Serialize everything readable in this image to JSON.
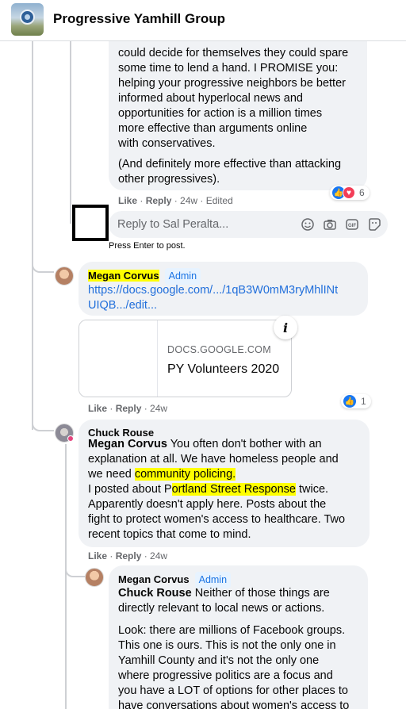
{
  "header": {
    "group_name": "Progressive Yamhill Group"
  },
  "comment1": {
    "lines": [
      "could decide for themselves they could spare",
      "some time to lend a hand. I PROMISE you:",
      "helping your progressive neighbors be better",
      "informed about hyperlocal news and",
      "opportunities for action is a million times",
      "more effective than arguments online",
      "with conservatives."
    ],
    "lines2": [
      "(And definitely more effective than attacking",
      "other progressives)."
    ],
    "like": "Like",
    "reply": "Reply",
    "time": "24w",
    "edited": "Edited",
    "reaction_count": "6"
  },
  "reply_box": {
    "placeholder": "Reply to Sal Peralta...",
    "hint": "Press Enter to post."
  },
  "comment2": {
    "author": "Megan Corvus",
    "badge": "Admin",
    "link_line1": "https://docs.google.com/.../1qB3W0mM3ryMhlINt",
    "link_line2": "UIQB.../edit...",
    "card_domain": "DOCS.GOOGLE.COM",
    "card_title": "PY Volunteers 2020",
    "info": "i",
    "like": "Like",
    "reply": "Reply",
    "time": "24w",
    "reaction_count": "1"
  },
  "comment3": {
    "author": "Chuck Rouse",
    "mention": "Megan Corvus",
    "t1": " You often don't bother with an",
    "t2": "explanation at all. We have homeless people and",
    "t3a": "we need ",
    "t3hl": "community policing.",
    "t4a": "I posted about P",
    "t4hl": "ortland Street Response",
    "t4b": " twice.",
    "t5": "Apparently doesn't apply here. Posts about the",
    "t6": "fight to protect women's access to healthcare. Two",
    "t7": "recent topics that come to mind.",
    "like": "Like",
    "reply": "Reply",
    "time": "24w"
  },
  "comment4": {
    "author": "Megan Corvus",
    "badge": "Admin",
    "mention": "Chuck Rouse",
    "t1": " Neither of those things are",
    "t2": "directly relevant to local news or actions.",
    "p2": [
      "Look: there are millions of Facebook groups.",
      "This one is ours. This is not the only one in",
      "Yamhill County and it's not the only one",
      "where progressive politics are a focus and",
      "you have a LOT of options for other places to",
      "have conversations about women's access to"
    ]
  },
  "colors": {
    "accent": "#1877f2",
    "highlight": "#ffff00",
    "link": "#216fdb",
    "bubble": "#f0f2f5"
  }
}
